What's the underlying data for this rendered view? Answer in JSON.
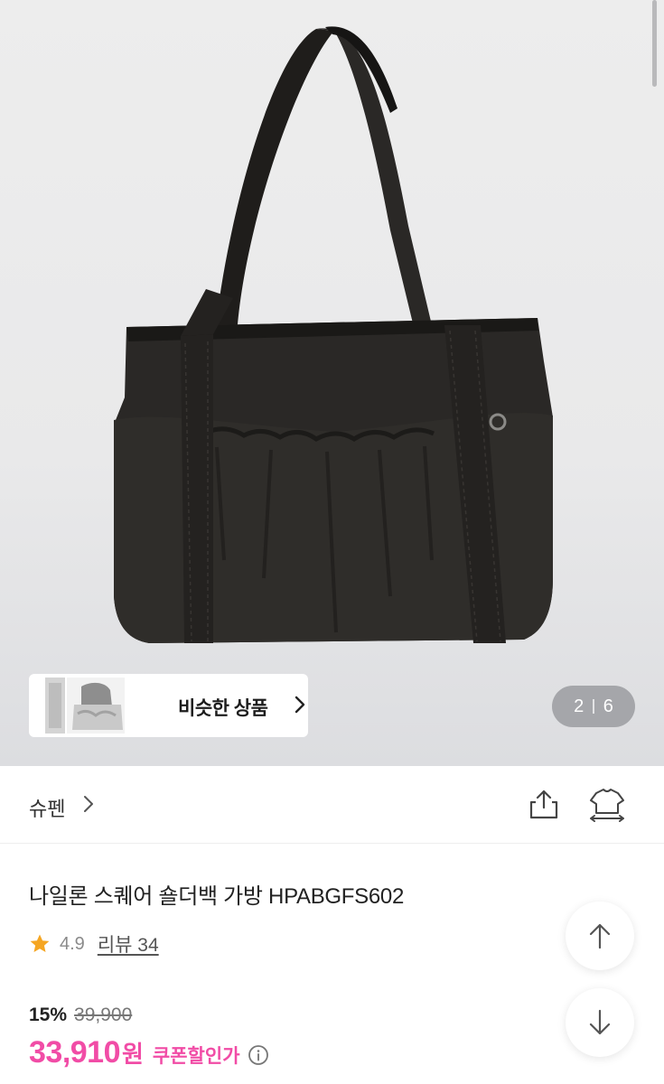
{
  "gallery": {
    "current": "2",
    "total": "6",
    "similar_label": "비슷한 상품"
  },
  "brand": {
    "name": "슈펜"
  },
  "product": {
    "title": "나일론 스퀘어 숄더백 가방 HPABGFS602",
    "rating": "4.9",
    "review_label": "리뷰 34",
    "discount": "15%",
    "original_price": "39,900",
    "sale_price": "33,910",
    "currency": "원",
    "coupon_label": "쿠폰할인가"
  },
  "colors": {
    "accent": "#f14ca6",
    "star": "#f5a623",
    "bag": "#272522"
  },
  "icons": [
    "share-icon",
    "fit-icon",
    "star-icon",
    "info-icon",
    "arrow-up-icon",
    "arrow-down-icon",
    "chevron-right-icon"
  ]
}
